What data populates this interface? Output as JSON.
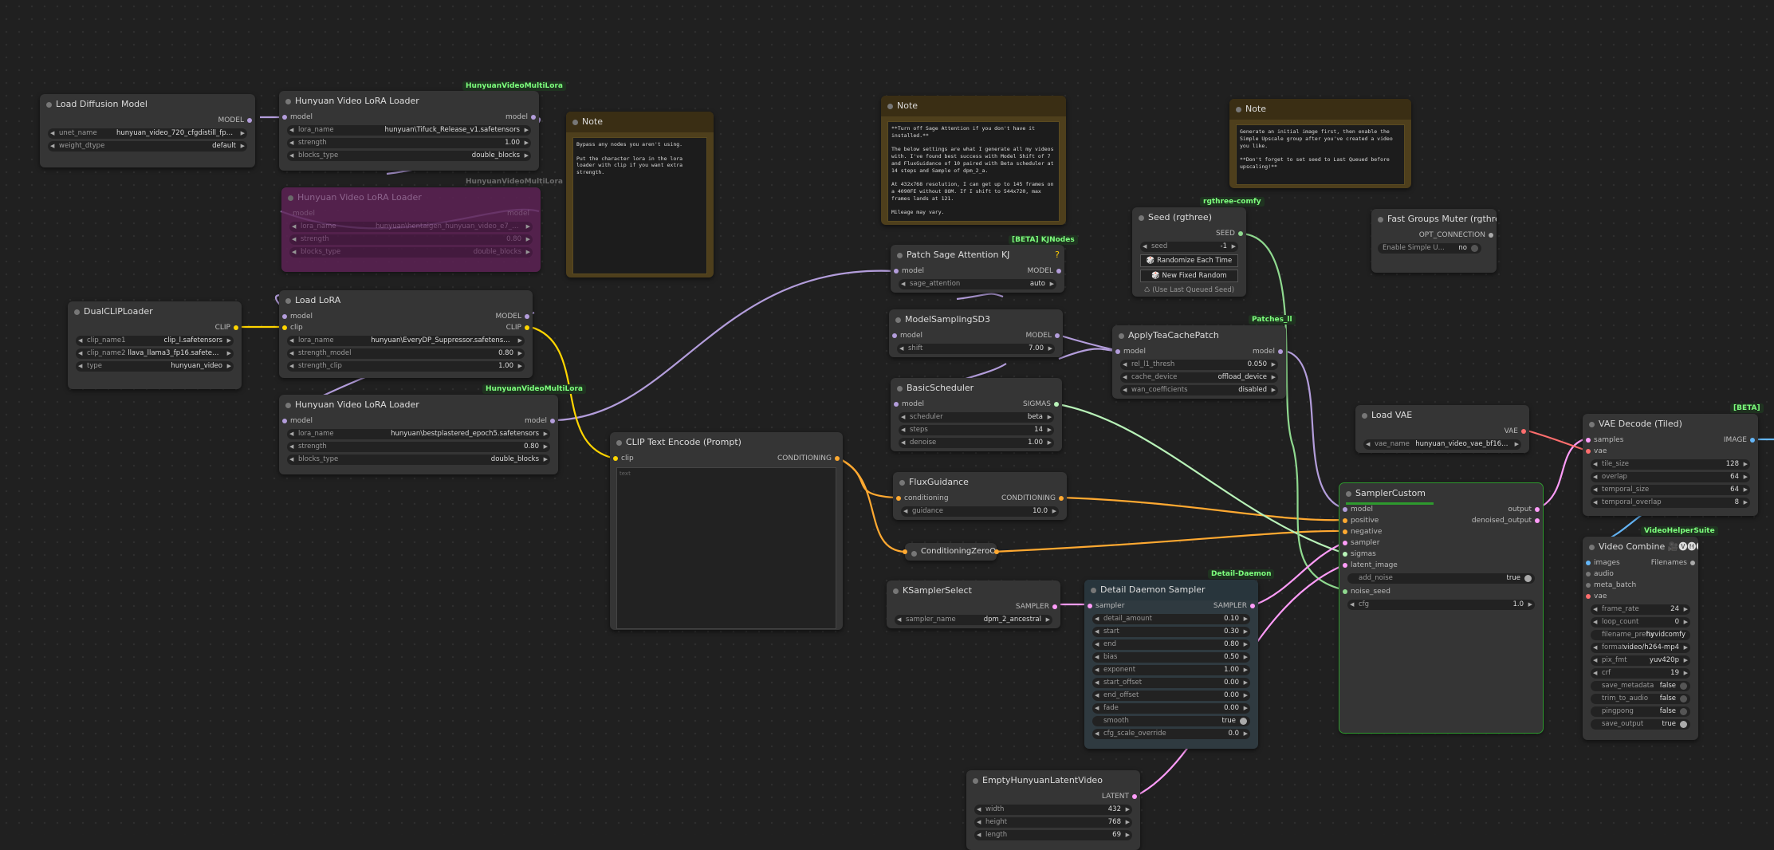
{
  "colors": {
    "model": "#b39ddb",
    "clip": "#ffd500",
    "conditioning": "#ffa931",
    "sigmas": "#b8f2b8",
    "sampler": "#ff9cf9",
    "latent": "#ff9cf9",
    "vae": "#ff6e6e",
    "image": "#64b5f6",
    "int": "#8fd98f",
    "background": "#202020",
    "badge": "#7dff7d"
  },
  "nodes": {
    "load_diffusion": {
      "title": "Load Diffusion Model",
      "out": "MODEL",
      "widgets": [
        {
          "label": "unet_name",
          "value": "hunyuan_video_720_cfgdistill_fp8_e4m3fn..."
        },
        {
          "label": "weight_dtype",
          "value": "default"
        }
      ]
    },
    "lora1": {
      "title": "Hunyuan Video LoRA Loader",
      "badge": "HunyuanVideoMultiLora",
      "in": "model",
      "out": "model",
      "widgets": [
        {
          "label": "lora_name",
          "value": "hunyuan\\Tifuck_Release_v1.safetensors"
        },
        {
          "label": "strength",
          "value": "1.00"
        },
        {
          "label": "blocks_type",
          "value": "double_blocks"
        }
      ]
    },
    "lora_bypass": {
      "title": "Hunyuan Video LoRA Loader",
      "badge": "HunyuanVideoMultiLora",
      "in": "model",
      "out": "model",
      "widgets": [
        {
          "label": "lora_name",
          "value": "hunyuan\\hentaigen_hunyuan_video_e7_v18.safetensors"
        },
        {
          "label": "strength",
          "value": "0.80"
        },
        {
          "label": "blocks_type",
          "value": "double_blocks"
        }
      ]
    },
    "note1": {
      "title": "Note",
      "text": "Bypass any nodes you aren't using.\n\nPut the character lora in the lora loader with clip if you want extra strength."
    },
    "dualclip": {
      "title": "DualCLIPLoader",
      "out": "CLIP",
      "widgets": [
        {
          "label": "clip_name1",
          "value": "clip_l.safetensors"
        },
        {
          "label": "clip_name2",
          "value": "llava_llama3_fp16.safetensors"
        },
        {
          "label": "type",
          "value": "hunyuan_video"
        }
      ]
    },
    "loadlora": {
      "title": "Load LoRA",
      "in1": "model",
      "in2": "clip",
      "out1": "MODEL",
      "out2": "CLIP",
      "widgets": [
        {
          "label": "lora_name",
          "value": "hunyuan\\EveryDP_Suppressor.safetensors"
        },
        {
          "label": "strength_model",
          "value": "0.80"
        },
        {
          "label": "strength_clip",
          "value": "1.00"
        }
      ]
    },
    "lora2": {
      "title": "Hunyuan Video LoRA Loader",
      "badge": "HunyuanVideoMultiLora",
      "in": "model",
      "out": "model",
      "widgets": [
        {
          "label": "lora_name",
          "value": "hunyuan\\bestplastered_epoch5.safetensors"
        },
        {
          "label": "strength",
          "value": "0.80"
        },
        {
          "label": "blocks_type",
          "value": "double_blocks"
        }
      ]
    },
    "clipenc": {
      "title": "CLIP Text Encode (Prompt)",
      "in": "clip",
      "out": "CONDITIONING",
      "placeholder": "text"
    },
    "note2": {
      "title": "Note",
      "text": "**Turn off Sage Attention if you don't have it installed.**\n\nThe below settings are what I generate all my videos with. I've found best success with Model Shift of 7 and FluxGuidance of 10 paired with Beta scheduler at 14 steps and Sample of dpm_2_a.\n\nAt 432x768 resolution, I can get up to 145 frames on a 4090FE without OOM. If I shift to 544x720, max frames lands at 121.\n\nMileage may vary."
    },
    "note3": {
      "title": "Note",
      "text": "Generate an initial image first, then enable the Simple Upscale group after you've created a video you like.\n\n**Don't forget to set seed to Last Queued before upscaling!**"
    },
    "sage": {
      "title": "Patch Sage Attention KJ",
      "badge": "[BETA] KJNodes",
      "in": "model",
      "out": "MODEL",
      "widgets": [
        {
          "label": "sage_attention",
          "value": "auto"
        }
      ]
    },
    "msd3": {
      "title": "ModelSamplingSD3",
      "in": "model",
      "out": "MODEL",
      "widgets": [
        {
          "label": "shift",
          "value": "7.00"
        }
      ]
    },
    "sched": {
      "title": "BasicScheduler",
      "in": "model",
      "out": "SIGMAS",
      "widgets": [
        {
          "label": "scheduler",
          "value": "beta"
        },
        {
          "label": "steps",
          "value": "14"
        },
        {
          "label": "denoise",
          "value": "1.00"
        }
      ]
    },
    "flux": {
      "title": "FluxGuidance",
      "in": "conditioning",
      "out": "CONDITIONING",
      "widgets": [
        {
          "label": "guidance",
          "value": "10.0"
        }
      ]
    },
    "czo": {
      "title": "ConditioningZeroOut"
    },
    "ksel": {
      "title": "KSamplerSelect",
      "out": "SAMPLER",
      "widgets": [
        {
          "label": "sampler_name",
          "value": "dpm_2_ancestral"
        }
      ]
    },
    "dds": {
      "title": "Detail Daemon Sampler",
      "badge": "Detail-Daemon",
      "in": "sampler",
      "out": "SAMPLER",
      "widgets": [
        {
          "label": "detail_amount",
          "value": "0.10"
        },
        {
          "label": "start",
          "value": "0.30"
        },
        {
          "label": "end",
          "value": "0.80"
        },
        {
          "label": "bias",
          "value": "0.50"
        },
        {
          "label": "exponent",
          "value": "1.00"
        },
        {
          "label": "start_offset",
          "value": "0.00"
        },
        {
          "label": "end_offset",
          "value": "0.00"
        },
        {
          "label": "fade",
          "value": "0.00"
        }
      ],
      "smooth_label": "smooth",
      "smooth_value": "true",
      "cfg_override": {
        "label": "cfg_scale_override",
        "value": "0.0"
      }
    },
    "seed": {
      "title": "Seed (rgthree)",
      "badge": "rgthree-comfy",
      "out": "SEED",
      "widgets": [
        {
          "label": "seed",
          "value": "-1"
        }
      ],
      "btn1": "🎲 Randomize Each Time",
      "btn2": "🎲 New Fixed Random",
      "btn3": "♺ (Use Last Queued Seed)"
    },
    "teacache": {
      "title": "ApplyTeaCachePatch",
      "badge": "Patches_ll",
      "in": "model",
      "out": "model",
      "widgets": [
        {
          "label": "rel_l1_thresh",
          "value": "0.050"
        },
        {
          "label": "cache_device",
          "value": "offload_device"
        },
        {
          "label": "wan_coefficients",
          "value": "disabled"
        }
      ]
    },
    "fgm": {
      "title": "Fast Groups Muter (rgthree)",
      "out": "OPT_CONNECTION",
      "toggle_label": "Enable Simple U...",
      "toggle_value": "no"
    },
    "loadvae": {
      "title": "Load VAE",
      "out": "VAE",
      "widgets": [
        {
          "label": "vae_name",
          "value": "hunyuan_video_vae_bf16.saf..."
        }
      ]
    },
    "sc": {
      "title": "SamplerCustom",
      "inputs": [
        "model",
        "positive",
        "negative",
        "sampler",
        "sigmas",
        "latent_image"
      ],
      "outputs": [
        "output",
        "denoised_output"
      ],
      "add_noise_label": "add_noise",
      "add_noise_value": "true",
      "noise_seed": "noise_seed",
      "cfg": {
        "label": "cfg",
        "value": "1.0"
      }
    },
    "vaedec": {
      "title": "VAE Decode (Tiled)",
      "badge": "[BETA]",
      "in1": "samples",
      "in2": "vae",
      "out": "IMAGE",
      "widgets": [
        {
          "label": "tile_size",
          "value": "128"
        },
        {
          "label": "overlap",
          "value": "64"
        },
        {
          "label": "temporal_size",
          "value": "64"
        },
        {
          "label": "temporal_overlap",
          "value": "8"
        }
      ]
    },
    "vcomb": {
      "title": "Video Combine 🎥🅥🅗🅢",
      "badge": "VideoHelperSuite",
      "inputs": [
        "images",
        "audio",
        "meta_batch",
        "vae"
      ],
      "out": "Filenames",
      "widgets": [
        {
          "label": "frame_rate",
          "value": "24"
        },
        {
          "label": "loop_count",
          "value": "0"
        }
      ],
      "prefix_label": "filename_prefix",
      "prefix_value": "hyvidcomfy",
      "widgets2": [
        {
          "label": "format",
          "value": "video/h264-mp4"
        },
        {
          "label": "pix_fmt",
          "value": "yuv420p"
        },
        {
          "label": "crf",
          "value": "19"
        }
      ],
      "toggles": [
        {
          "label": "save_metadata",
          "value": "false"
        },
        {
          "label": "trim_to_audio",
          "value": "false"
        },
        {
          "label": "pingpong",
          "value": "false"
        },
        {
          "label": "save_output",
          "value": "true"
        }
      ]
    },
    "emptylat": {
      "title": "EmptyHunyuanLatentVideo",
      "out": "LATENT",
      "widgets": [
        {
          "label": "width",
          "value": "432"
        },
        {
          "label": "height",
          "value": "768"
        },
        {
          "label": "length",
          "value": "69"
        }
      ]
    }
  }
}
